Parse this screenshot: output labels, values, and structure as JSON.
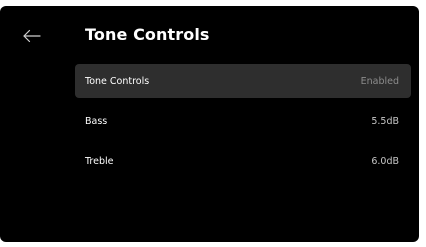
{
  "header": {
    "back_icon": "arrow-left-icon",
    "title": "Tone Controls"
  },
  "settings": [
    {
      "label": "Tone Controls",
      "value": "Enabled",
      "focused": true
    },
    {
      "label": "Bass",
      "value": "5.5dB",
      "focused": false
    },
    {
      "label": "Treble",
      "value": "6.0dB",
      "focused": false
    }
  ],
  "colors": {
    "background": "#000000",
    "focused_row": "#2e2e2e",
    "text_primary": "#ffffff",
    "text_secondary": "#c6c6c6",
    "text_dim": "#8c8c8c"
  }
}
